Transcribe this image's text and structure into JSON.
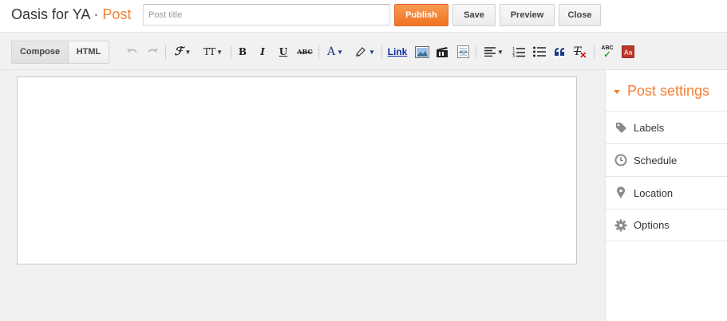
{
  "header": {
    "blog_name": "Oasis for YA",
    "separator": "·",
    "page_label": "Post",
    "title_placeholder": "Post title",
    "publish_label": "Publish",
    "save_label": "Save",
    "preview_label": "Preview",
    "close_label": "Close"
  },
  "toolbar": {
    "compose_label": "Compose",
    "html_label": "HTML",
    "link_label": "Link",
    "icons": [
      "undo-icon",
      "redo-icon",
      "font-family-icon",
      "font-size-icon",
      "bold-icon",
      "italic-icon",
      "underline-icon",
      "strikethrough-icon",
      "text-color-icon",
      "highlight-icon",
      "link",
      "insert-image-icon",
      "insert-video-icon",
      "insert-jump-break-icon",
      "align-icon",
      "numbered-list-icon",
      "bulleted-list-icon",
      "quote-icon",
      "remove-formatting-icon",
      "spellcheck-icon",
      "input-tools-icon"
    ],
    "strike_text": "ABC",
    "spell_text": "ABC",
    "text_color_glyph": "A",
    "font_family_glyph": "ℱ",
    "font_size_glyph": "TT",
    "bold_glyph": "B",
    "italic_glyph": "I",
    "underline_glyph": "U",
    "remove_format_glyph": "T"
  },
  "sidebar": {
    "title": "Post settings",
    "items": [
      {
        "label": "Labels",
        "icon": "tag-icon"
      },
      {
        "label": "Schedule",
        "icon": "clock-icon"
      },
      {
        "label": "Location",
        "icon": "map-pin-icon"
      },
      {
        "label": "Options",
        "icon": "gear-icon"
      }
    ]
  },
  "colors": {
    "accent": "#f57e32",
    "link": "#0b2fa6"
  }
}
